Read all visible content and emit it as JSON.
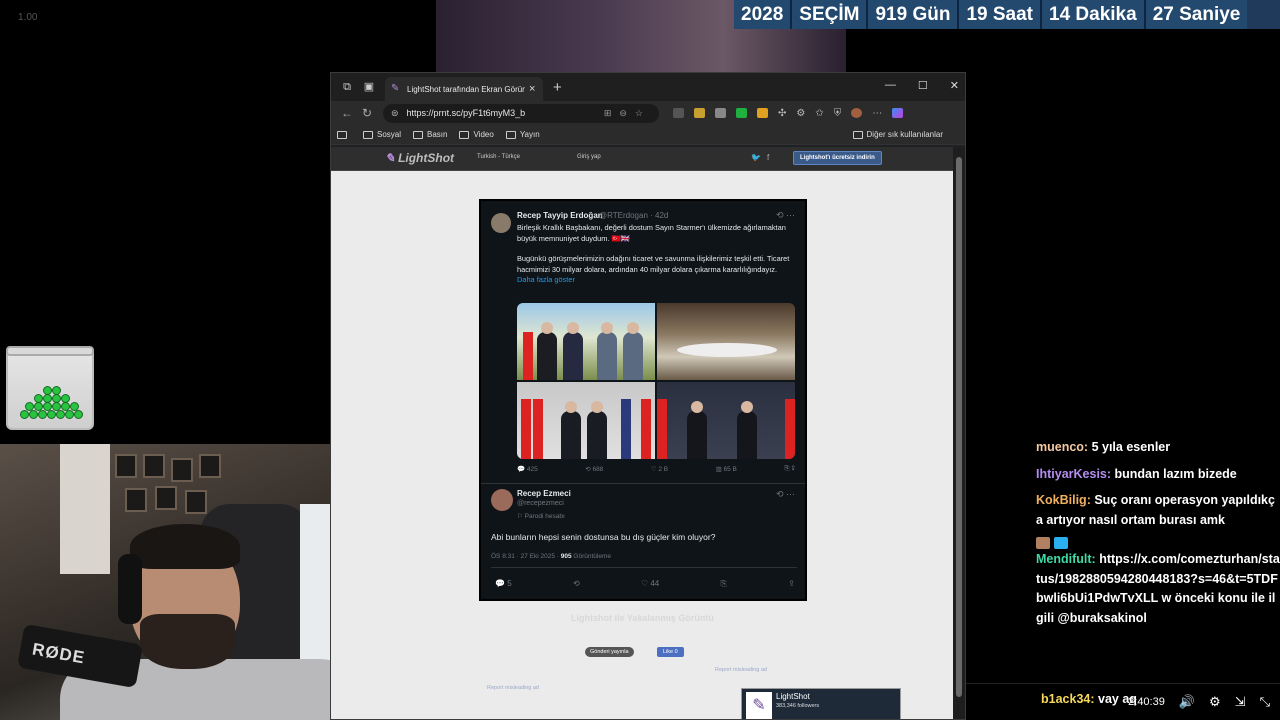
{
  "overlay": {
    "zoom_label": "1.00",
    "countdown": [
      "2028",
      "SEÇİM",
      "919 Gün",
      "19 Saat",
      "14 Dakika",
      "27 Saniye"
    ]
  },
  "webcam": {
    "mic_brand": "RØDE"
  },
  "browser": {
    "tab_title": "LightShot tarafından Ekran Görün",
    "url": "https://prnt.sc/pyF1t6myM3_b",
    "bookmarks": [
      "Sosyal",
      "Basın",
      "Video",
      "Yayın"
    ],
    "bookmarks_other": "Diğer sık kullanılanlar"
  },
  "lightshot": {
    "logo": "LightShot",
    "language": "Turkish - Türkçe",
    "login": "Giriş yap",
    "download_button": "Lightshot'ı ücretsiz indirin",
    "caption": "Lightshot ile Yakalanmış Görüntü",
    "caption_sub": "",
    "share_button": "Gönderi yayınla",
    "like_button": "Like 0",
    "report_1": "Report misleading ad",
    "report_2": "Report misleading ad",
    "widget_name": "LightShot",
    "widget_followers": "383,346 followers"
  },
  "tweet": {
    "author_name": "Recep Tayyip Erdoğan",
    "author_handle": "@RTErdogan · 42d",
    "text_1": "Birleşik Krallık Başbakanı, değerli dostum Sayın Starmer'ı ülkemizde ağırlamaktan büyük memnuniyet duydum. 🇹🇷🇬🇧",
    "text_2": "Bugünkü görüşmelerimizin odağını ticaret ve savunma ilişkilerimiz teşkil etti. Ticaret hacmimizi 30 milyar dolara, ardından 40 milyar dolara çıkarma kararlılığındayız.",
    "show_more": "Daha fazla göster",
    "stats": {
      "replies": "425",
      "retweets": "688",
      "likes": "2 B",
      "views": "65 B"
    }
  },
  "reply": {
    "name": "Recep Ezmeci",
    "handle": "@recepezmeci",
    "parody": "Parodi hesabı",
    "text": "Abi bunların hepsi senin dostunsa bu dış güçler kim oluyor?",
    "time": "ÖS 8:31 · 27 Eki 2025 ·",
    "views_count": "905",
    "views_label": "Görüntüleme",
    "replies": "5",
    "likes": "44"
  },
  "chat": [
    {
      "user": "muenco:",
      "color": "#f4c9a2",
      "text": "5 yıla esenler"
    },
    {
      "user": "IhtiyarKesis:",
      "color": "#b48cf0",
      "text": "bundan lazım bizede"
    },
    {
      "user": "KokBilig:",
      "color": "#f0b060",
      "text": "Suç oranı operasyon yapıldıkça artıyor nasıl ortam burası amk"
    },
    {
      "user": "Mendifult:",
      "color": "#3fd9a8",
      "text": "https://x.com/comezturhan/status/1982880594280448183?s=46&t=5TDFbwli6bUi1PdwTvXLL w önceki konu ile ilgili @buraksakinol"
    }
  ],
  "chat_last": {
    "user": "b1ack34:",
    "color": "#f7d85a",
    "text": "vay aq"
  },
  "player": {
    "time": "2:40:39"
  }
}
